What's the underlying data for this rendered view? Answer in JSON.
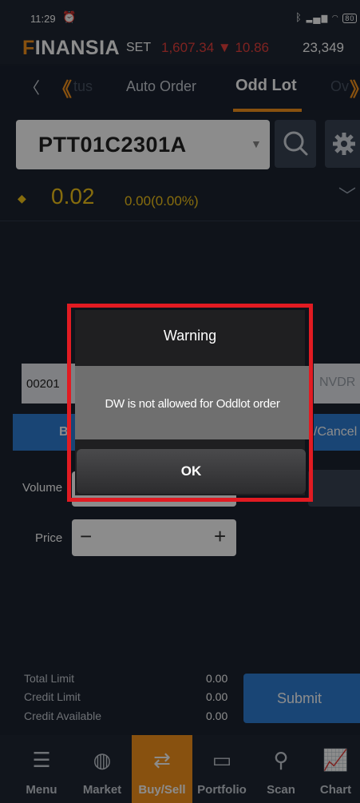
{
  "status_bar": {
    "time": "11:29",
    "alarm_icon": "alarm-icon",
    "battery": "80"
  },
  "header": {
    "logo": "FINANSIA",
    "market": "SET",
    "index_value": "1,607.34",
    "index_change": "▼ 10.86",
    "volume": "23,349"
  },
  "tabs": {
    "back": "〈",
    "prev": "《",
    "status": "tus",
    "auto_order": "Auto Order",
    "odd_lot": "Odd Lot",
    "next_partial": "Ov",
    "next": "》"
  },
  "symbol": {
    "value": "PTT01C2301A",
    "caret": "▼"
  },
  "price": {
    "last": "0.02",
    "change": "0.00(0.00%)"
  },
  "order": {
    "account": "00201",
    "nvdr": "NVDR",
    "buy": "B",
    "cancel": "/Cancel",
    "volume_label": "Volume",
    "price_label": "Price",
    "minus": "−",
    "plus": "+"
  },
  "limits": {
    "total_limit_label": "Total Limit",
    "total_limit_value": "0.00",
    "credit_limit_label": "Credit Limit",
    "credit_limit_value": "0.00",
    "credit_available_label": "Credit Available",
    "credit_available_value": "0.00",
    "submit": "Submit"
  },
  "nav": [
    {
      "label": "Menu",
      "icon": "list-icon"
    },
    {
      "label": "Market",
      "icon": "globe-icon"
    },
    {
      "label": "Buy/Sell",
      "icon": "swap-icon"
    },
    {
      "label": "Portfolio",
      "icon": "wallet-icon"
    },
    {
      "label": "Scan",
      "icon": "search-icon"
    },
    {
      "label": "Chart",
      "icon": "chart-icon"
    }
  ],
  "dialog": {
    "title": "Warning",
    "message": "DW is not allowed for Oddlot order",
    "ok": "OK",
    "highlight_color": "#e11b22"
  },
  "colors": {
    "accent": "#f7941d",
    "down": "#e8403c",
    "price": "#f5c518",
    "primary": "#2f7fd6"
  }
}
